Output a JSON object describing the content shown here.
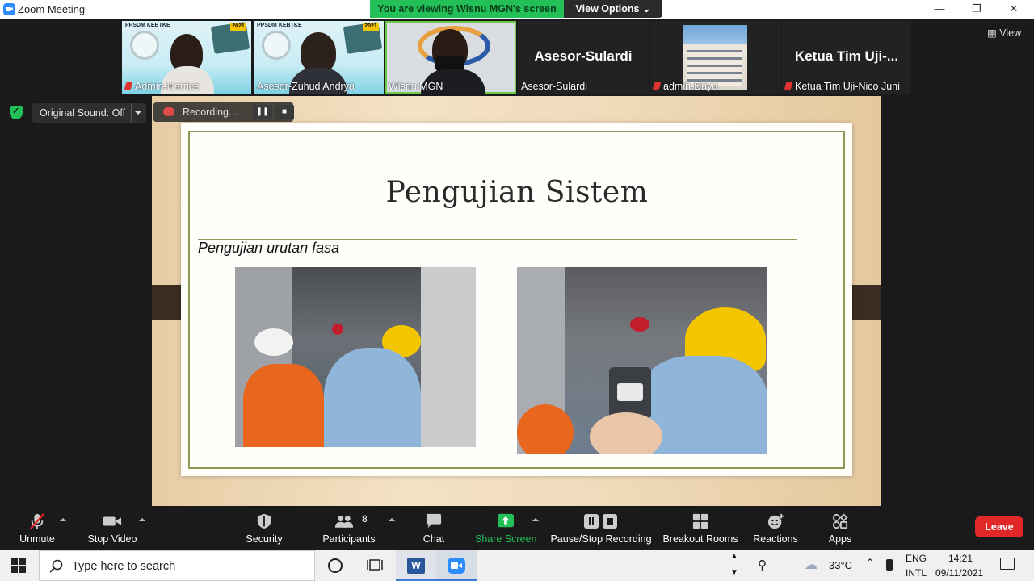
{
  "window": {
    "title": "Zoom Meeting"
  },
  "banner": {
    "viewing": "You are viewing Wisnu MGN's screen",
    "view_options": "View Options"
  },
  "gallery": {
    "view_label": "View",
    "participants": [
      {
        "name": "Admin-Harries",
        "muted": true,
        "video": true
      },
      {
        "name": "Asesor-Zuhud Andrya",
        "muted": false,
        "video": true
      },
      {
        "name": "Wisnu MGN",
        "muted": false,
        "video": true,
        "speaking": true
      },
      {
        "name": "Asesor-Sulardi",
        "big_name": "Asesor-Sulardi",
        "muted": false,
        "video": false
      },
      {
        "name": "admin-Dayu",
        "muted": true,
        "video": true
      },
      {
        "name": "Ketua Tim Uji-Nico Juni",
        "big_name": "Ketua Tim Uji-...",
        "muted": true,
        "video": false
      }
    ],
    "tile_header": "PPSDM KEBTKE",
    "tile_year": "2021"
  },
  "original_sound": "Original Sound: Off",
  "recording": {
    "status": "Recording..."
  },
  "slide": {
    "title": "Pengujian Sistem",
    "subtitle": "Pengujian urutan fasa"
  },
  "toolbar": {
    "unmute": "Unmute",
    "stop_video": "Stop Video",
    "security": "Security",
    "participants": "Participants",
    "participants_count": "8",
    "chat": "Chat",
    "share_screen": "Share Screen",
    "pause_recording": "Pause/Stop Recording",
    "breakout": "Breakout Rooms",
    "reactions": "Reactions",
    "apps": "Apps",
    "leave": "Leave"
  },
  "taskbar": {
    "search_placeholder": "Type here to search",
    "temperature": "33°C",
    "lang_top": "ENG",
    "lang_bottom": "INTL",
    "time": "14:21",
    "date": "09/11/2021"
  },
  "colors": {
    "share_green": "#23c058",
    "leave_red": "#e02828",
    "slide_accent": "#8d9a58"
  }
}
